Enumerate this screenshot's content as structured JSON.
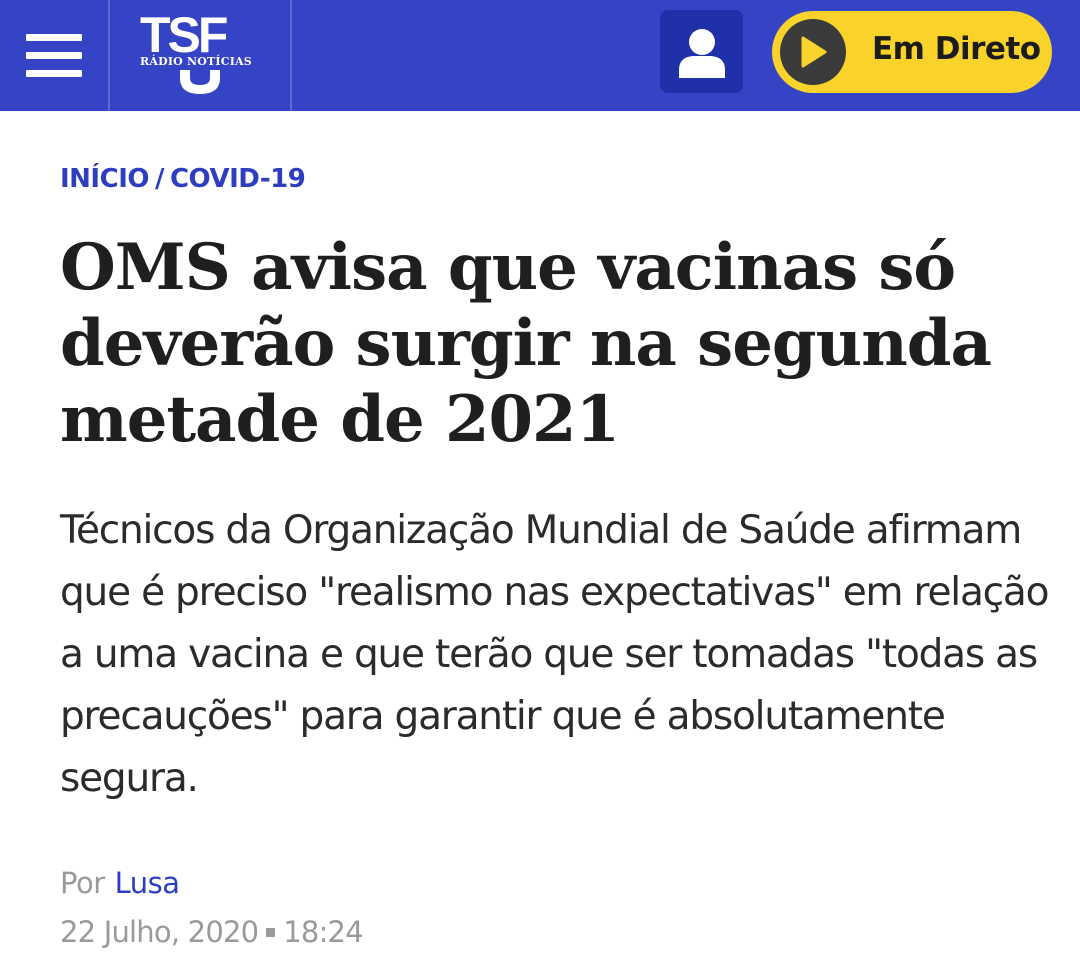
{
  "header": {
    "logo_text": "TSF",
    "logo_subtitle": "RÁDIO NOTÍCIAS",
    "live_label": "Em Direto",
    "colors": {
      "bar": "#3444c4",
      "live_button": "#fad32a",
      "user_button": "#2030a8"
    }
  },
  "breadcrumb": {
    "home": "INÍCIO",
    "separator": "/",
    "section": "COVID-19"
  },
  "article": {
    "headline": "OMS avisa que vacinas só deverão surgir na segunda metade de 2021",
    "lead": "Técnicos da Organização Mundial de Saúde afirmam que é preciso \"realismo nas expectativas\" em relação a uma vacina e que terão que ser tomadas \"todas as precauções\" para garantir que é absolutamente segura.",
    "by_prefix": "Por",
    "author": "Lusa",
    "date": "22 Julho, 2020",
    "time": "18:24"
  },
  "icons": [
    "menu-icon",
    "user-icon",
    "play-icon"
  ]
}
